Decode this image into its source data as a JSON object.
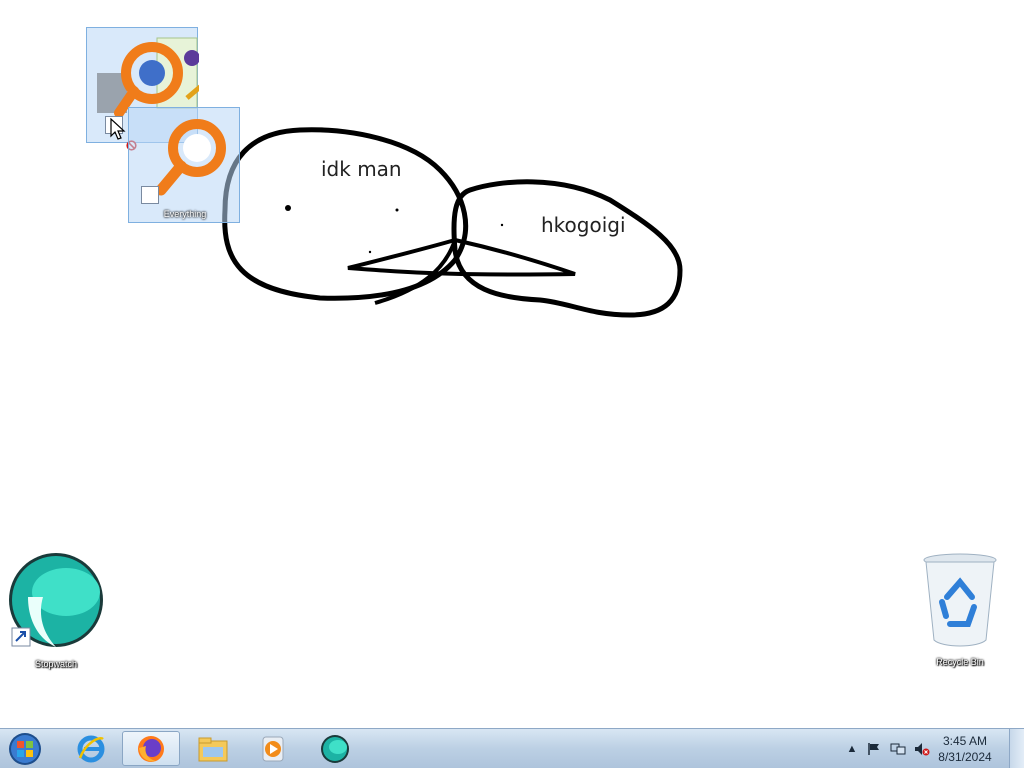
{
  "desktop": {
    "drawing": {
      "text1": "idk man",
      "text2": "hkogoigi"
    },
    "icons": {
      "stopwatch_label": "Stopwatch",
      "recycle_label": "Recycle Bin",
      "everything_label": "Everything",
      "dragged_label": "Everything"
    }
  },
  "taskbar": {
    "start": "start-orb-icon",
    "pinned": [
      {
        "name": "internet-explorer-icon"
      },
      {
        "name": "firefox-icon",
        "active": true
      },
      {
        "name": "file-explorer-icon"
      },
      {
        "name": "media-player-icon"
      },
      {
        "name": "stopwatch-app-icon"
      }
    ],
    "tray": {
      "show_hidden": "▲",
      "time": "3:45 AM",
      "date": "8/31/2024"
    }
  },
  "colors": {
    "taskbar_top": "#d8e6f3",
    "taskbar_bottom": "#aec4dc",
    "everything_orange": "#f07c1a",
    "stopwatch_teal": "#19b8a6"
  }
}
